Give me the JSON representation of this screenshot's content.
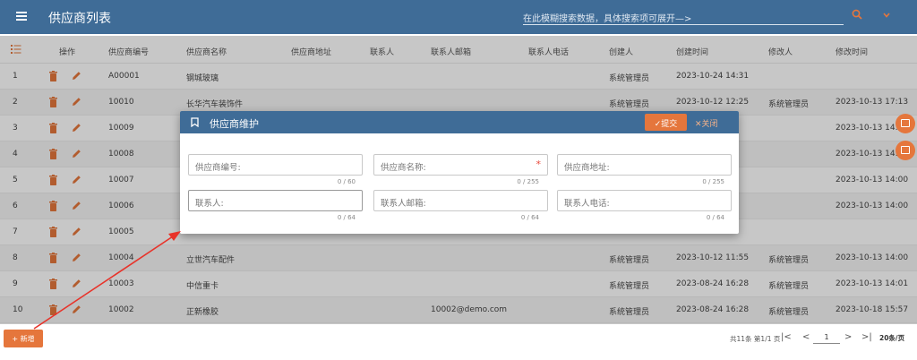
{
  "app": {
    "title": "供应商列表",
    "search_placeholder": "在此模糊搜索数据，具体搜索项可展开—>"
  },
  "table": {
    "headers": [
      "操作",
      "供应商编号",
      "供应商名称",
      "供应商地址",
      "联系人",
      "联系人邮箱",
      "联系人电话",
      "创建人",
      "创建时间",
      "修改人",
      "修改时间"
    ],
    "rows": [
      {
        "no": "1",
        "code": "A00001",
        "name": "钢城玻璃",
        "email": "",
        "creator": "系统管理员",
        "created": "2023-10-24 14:31",
        "modifier": "",
        "modified": ""
      },
      {
        "no": "2",
        "code": "10010",
        "name": "长华汽车装饰件",
        "email": "",
        "creator": "系统管理员",
        "created": "2023-10-12 12:25",
        "modifier": "系统管理员",
        "modified": "2023-10-13 17:13"
      },
      {
        "no": "3",
        "code": "10009",
        "name": "",
        "email": "",
        "creator": "",
        "created": "",
        "modifier": "",
        "modified": "2023-10-13 14:14"
      },
      {
        "no": "4",
        "code": "10008",
        "name": "",
        "email": "",
        "creator": "",
        "created": "",
        "modifier": "",
        "modified": "2023-10-13 14:14"
      },
      {
        "no": "5",
        "code": "10007",
        "name": "",
        "email": "",
        "creator": "",
        "created": "",
        "modifier": "",
        "modified": "2023-10-13 14:00"
      },
      {
        "no": "6",
        "code": "10006",
        "name": "",
        "email": "",
        "creator": "",
        "created": "",
        "modifier": "",
        "modified": "2023-10-13 14:00"
      },
      {
        "no": "7",
        "code": "10005",
        "name": "",
        "email": "",
        "creator": "",
        "created": "",
        "modifier": "",
        "modified": ""
      },
      {
        "no": "8",
        "code": "10004",
        "name": "立世汽车配件",
        "email": "",
        "creator": "系统管理员",
        "created": "2023-10-12 11:55",
        "modifier": "系统管理员",
        "modified": "2023-10-13 14:00"
      },
      {
        "no": "9",
        "code": "10003",
        "name": "中信重卡",
        "email": "",
        "creator": "系统管理员",
        "created": "2023-08-24 16:28",
        "modifier": "系统管理员",
        "modified": "2023-10-13 14:01"
      },
      {
        "no": "10",
        "code": "10002",
        "name": "正新橡胶",
        "email": "10002@demo.com",
        "creator": "系统管理员",
        "created": "2023-08-24 16:28",
        "modifier": "系统管理员",
        "modified": "2023-10-18 15:57"
      }
    ]
  },
  "dialog": {
    "title": "供应商维护",
    "submit_label": "✓提交",
    "close_label": "✕关闭",
    "fields": [
      {
        "label": "供应商编号:",
        "counter": "0 / 60",
        "required": false
      },
      {
        "label": "供应商名称:",
        "counter": "0 / 255",
        "required": true,
        "required_mark": "*"
      },
      {
        "label": "供应商地址:",
        "counter": "0 / 255",
        "required": false
      },
      {
        "label": "联系人:",
        "counter": "0 / 64",
        "required": false
      },
      {
        "label": "联系人邮箱:",
        "counter": "0 / 64",
        "required": false
      },
      {
        "label": "联系人电话:",
        "counter": "0 / 64",
        "required": false
      }
    ]
  },
  "footer": {
    "add_label": "+ 新增",
    "pager_info": "共11条 第1/1 页",
    "first": "|<",
    "prev": "<",
    "page": "1",
    "next": ">",
    "last": ">|",
    "per_page": "20条/页"
  },
  "colors": {
    "primary": "#3f6c97",
    "accent": "#e5763c",
    "annotation_arrow": "#e8332a"
  }
}
